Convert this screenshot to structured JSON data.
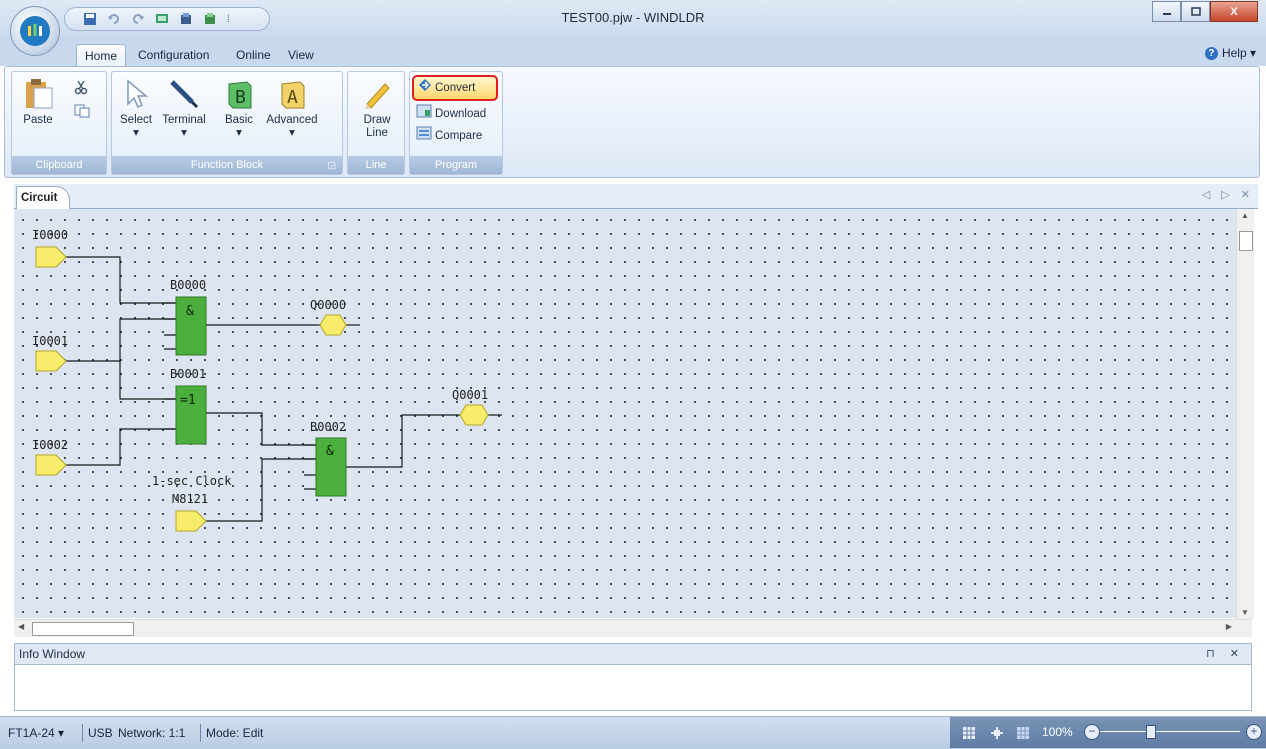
{
  "window": {
    "title": "TEST00.pjw - WINDLDR",
    "controls": {
      "minimize": "▭",
      "maximize": "▢",
      "close": "X"
    }
  },
  "ribbon": {
    "tabs": [
      "Home",
      "Configuration",
      "Online",
      "View"
    ],
    "active_tab": "Home",
    "help_label": "Help ▾",
    "groups": {
      "clipboard": {
        "label": "Clipboard",
        "paste": "Paste"
      },
      "function_block": {
        "label": "Function Block",
        "select": "Select",
        "terminal": "Terminal",
        "basic": "Basic",
        "advanced": "Advanced"
      },
      "line": {
        "label": "Line",
        "draw_line_1": "Draw",
        "draw_line_2": "Line"
      },
      "program": {
        "label": "Program",
        "convert": "Convert",
        "download": "Download",
        "compare": "Compare"
      }
    }
  },
  "circuit": {
    "tab_label": "Circuit",
    "pane_controls": "◁ ▷ ✕",
    "inputs": [
      {
        "label": "I0000"
      },
      {
        "label": "I0001"
      },
      {
        "label": "I0002"
      },
      {
        "label": "M8121",
        "caption": "1-sec Clock"
      }
    ],
    "blocks": [
      {
        "label": "B0000",
        "op": "&"
      },
      {
        "label": "B0001",
        "op": "=1"
      },
      {
        "label": "B0002",
        "op": "&"
      }
    ],
    "outputs": [
      {
        "label": "Q0000"
      },
      {
        "label": "Q0001"
      }
    ],
    "colors": {
      "block": "#4cae3c",
      "terminal": "#f7ec6b",
      "canvas": "#dde6f0",
      "highlight": "#e02020"
    }
  },
  "info_window": {
    "title": "Info Window",
    "controls": "⊓ ✕"
  },
  "statusbar": {
    "plc": "FT1A-24 ▾",
    "connection": "USB",
    "network": "Network: 1:1",
    "mode": "Mode: Edit",
    "zoom": "100%"
  }
}
